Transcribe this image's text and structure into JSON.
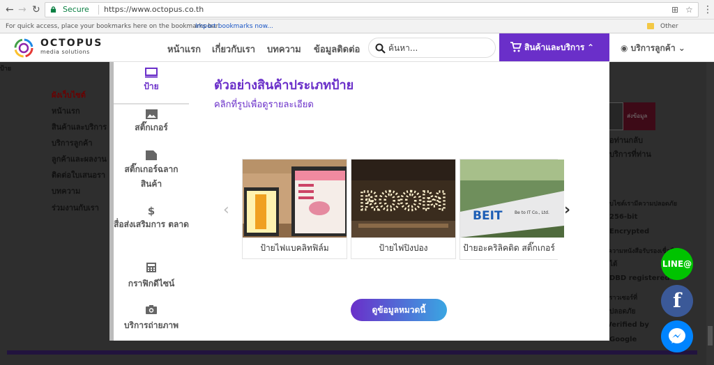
{
  "browser": {
    "secure_label": "Secure",
    "url": "https://www.octopus.co.th",
    "bookmarks_hint": "For quick access, place your bookmarks here on the bookmarks bar.",
    "import_link": "Import bookmarks now...",
    "other_bookmarks": "Other bookmarks"
  },
  "site": {
    "logo_name": "OCTOPUS",
    "logo_sub": "media solutions",
    "menu": [
      "หน้าแรก",
      "เกี่ยวกับเรา",
      "บทความ",
      "ข้อมูลติดต่อ"
    ],
    "search_placeholder": "ค้นหา...",
    "products_label": "สินค้าและบริการ",
    "account_label": "บริการลูกค้า"
  },
  "background": {
    "sitemap_header": "ผังเว็บไซต์",
    "sitemap_items": [
      "หน้าแรก",
      "สินค้าและบริการ",
      "บริการลูกค้า",
      "ลูกค้าและผลงาน",
      "ติดต่อใบเสนอรา",
      "บทความ",
      "ร่วมงานกับเรา"
    ],
    "left_clip": "ป้าย",
    "submit_label": "ส่งข้อมูล",
    "right_text_1": "อท่านกลับ",
    "right_text_2": "บริการที่ท่าน",
    "security_lines": [
      "เว็บไซต์เรามีความปลอดภัย",
      "256-bit",
      "Encrypted",
      "มีความหนังสือรับรองเชื่อถือ",
      "ได้",
      "DBD registered",
      "บราวเซอร์ที่",
      "ปลอดภัย",
      "Verified by",
      "Google"
    ]
  },
  "categories": [
    {
      "icon": "monitor-icon",
      "label": "ป้าย",
      "active": true
    },
    {
      "icon": "image-icon",
      "label": "สติ๊กเกอร์",
      "active": false
    },
    {
      "icon": "label-icon",
      "label": "สติ๊กเกอร์ฉลาก สินค้า",
      "active": false
    },
    {
      "icon": "dollar-icon",
      "label": "สื่อส่งเสริมการ ตลาด",
      "active": false
    },
    {
      "icon": "calculator-icon",
      "label": "กราฟิกดีไซน์",
      "active": false
    },
    {
      "icon": "camera-icon",
      "label": "บริการถ่ายภาพ",
      "active": false
    }
  ],
  "section": {
    "title": "ตัวอย่างสินค้าประเภทป้าย",
    "subtitle": "คลิกที่รูปเพื่อดูรายละเอียด",
    "cta_label": "ดูข้อมูลหมวดนี้"
  },
  "products": [
    {
      "label": "ป้ายไฟแบคลิทฟิล์ม"
    },
    {
      "label": "ป้ายไฟปิงปอง",
      "sign_text": "ROOM"
    },
    {
      "label": "ป้ายอะคริลิคติด สติ๊กเกอร์",
      "sign_text": "BEIT",
      "sign_small": "Be to IT Co., Ltd."
    }
  ],
  "social": {
    "line_label": "LINE@",
    "facebook_label": "f"
  },
  "colors": {
    "brand_purple": "#6a2fc9",
    "line_green": "#00c300",
    "facebook_blue": "#3b5998",
    "messenger_blue": "#0084ff"
  }
}
